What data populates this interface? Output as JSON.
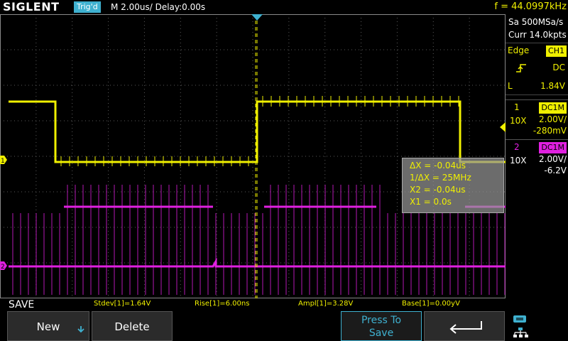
{
  "header": {
    "logo": "SIGLENT",
    "trigger_state": "Trig'd",
    "timebase": "M 2.00us/  Delay:0.00s",
    "frequency": "f = 44.0997kHz"
  },
  "acquisition": {
    "sample_rate": "Sa 500MSa/s",
    "memory": "Curr 14.0kpts"
  },
  "trigger": {
    "type": "Edge",
    "source": "CH1",
    "coupling": "DC",
    "level_label": "L",
    "level": "1.84V"
  },
  "channels": [
    {
      "number": "1",
      "coupling": "DC1M",
      "probe": "10X",
      "scale": "2.00V/",
      "offset": "-280mV",
      "color": "#f0f000"
    },
    {
      "number": "2",
      "coupling": "DC1M",
      "probe": "10X",
      "scale": "2.00V/",
      "offset": "-6.2V",
      "color": "#e020e0"
    }
  ],
  "cursor_readout": {
    "delta_x": "ΔX = -0.04us",
    "inv_delta_x": "1/ΔX = 25MHz",
    "x2": "X2 = -0.04us",
    "x1": "X1 = 0.0s"
  },
  "measurements": {
    "stdev": "Stdev[1]=1.64V",
    "rise": "Rise[1]=6.00ns",
    "ampl": "Ampl[1]=3.28V",
    "base": "Base[1]=0.00yV"
  },
  "menu": {
    "title": "SAVE",
    "new_label": "New",
    "delete_label": "Delete",
    "press_to_save_line1": "Press To",
    "press_to_save_line2": "Save"
  },
  "markers": {
    "ch1": "1",
    "ch2": "2"
  },
  "colors": {
    "ch1": "#f0f000",
    "ch2": "#e020e0",
    "accent": "#3fb1d0",
    "trigger_cursor": "#3fb1d0"
  }
}
